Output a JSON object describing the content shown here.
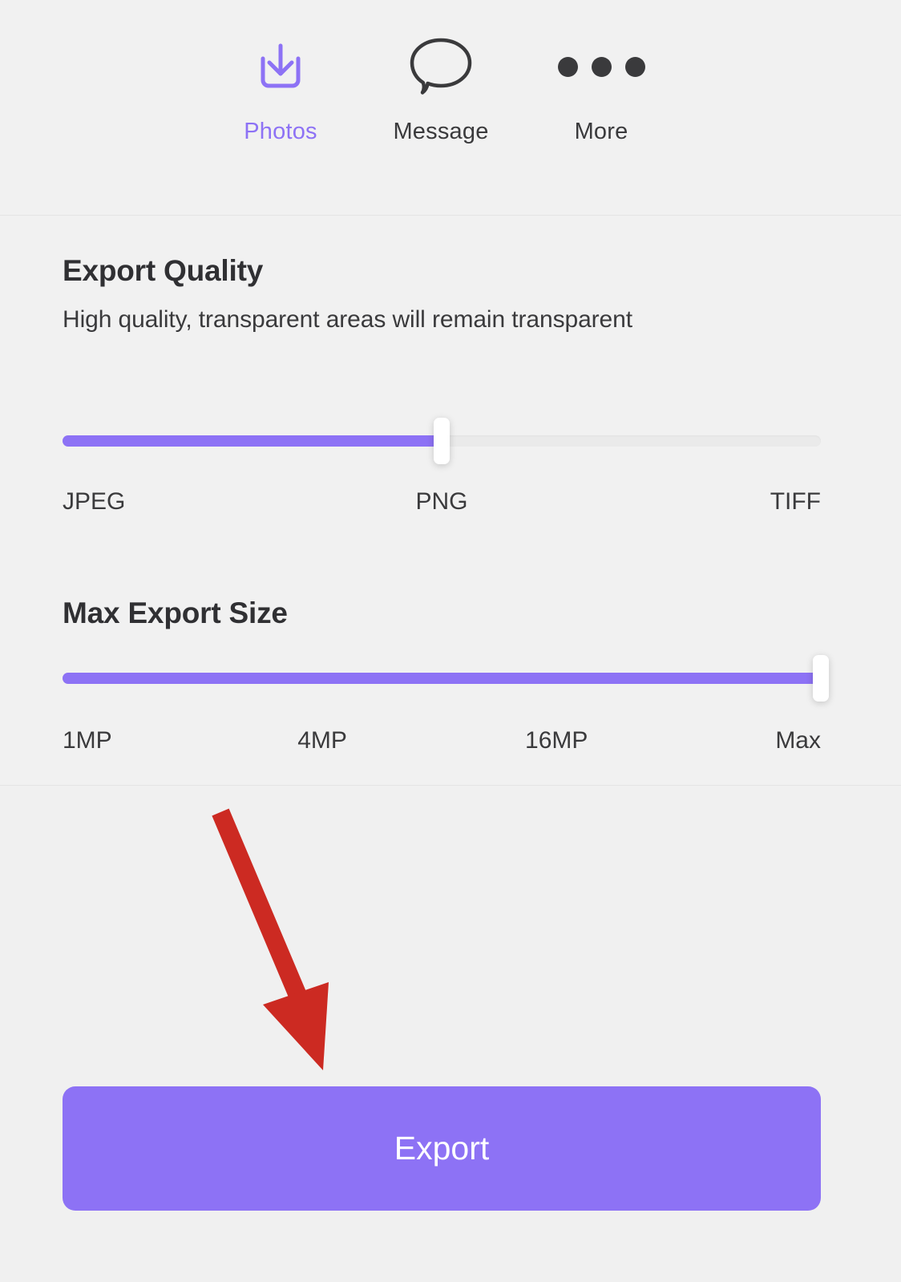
{
  "share_bar": {
    "items": [
      {
        "label": "Photos",
        "icon": "download-icon",
        "active": true
      },
      {
        "label": "Message",
        "icon": "speech-bubble-icon",
        "active": false
      },
      {
        "label": "More",
        "icon": "ellipsis-icon",
        "active": false
      }
    ]
  },
  "export_quality": {
    "title": "Export Quality",
    "subtitle": "High quality, transparent areas will remain transparent",
    "slider": {
      "value_label": "PNG",
      "fill_percent": 50,
      "ticks": [
        "JPEG",
        "PNG",
        "TIFF"
      ]
    }
  },
  "max_export_size": {
    "title": "Max Export Size",
    "slider": {
      "value_label": "Max",
      "fill_percent": 100,
      "ticks": [
        "1MP",
        "4MP",
        "16MP",
        "Max"
      ]
    }
  },
  "annotation": {
    "name": "red-arrow",
    "color": "#cc2a22",
    "points_to": "Export"
  },
  "export_button": {
    "label": "Export"
  },
  "colors": {
    "accent": "#8d72f5",
    "background": "#f0f0f0",
    "panel": "#f1f1f1",
    "text": "#3a3a3c",
    "heading": "#303033",
    "annotation": "#cc2a22",
    "track": "#eaeaea"
  }
}
